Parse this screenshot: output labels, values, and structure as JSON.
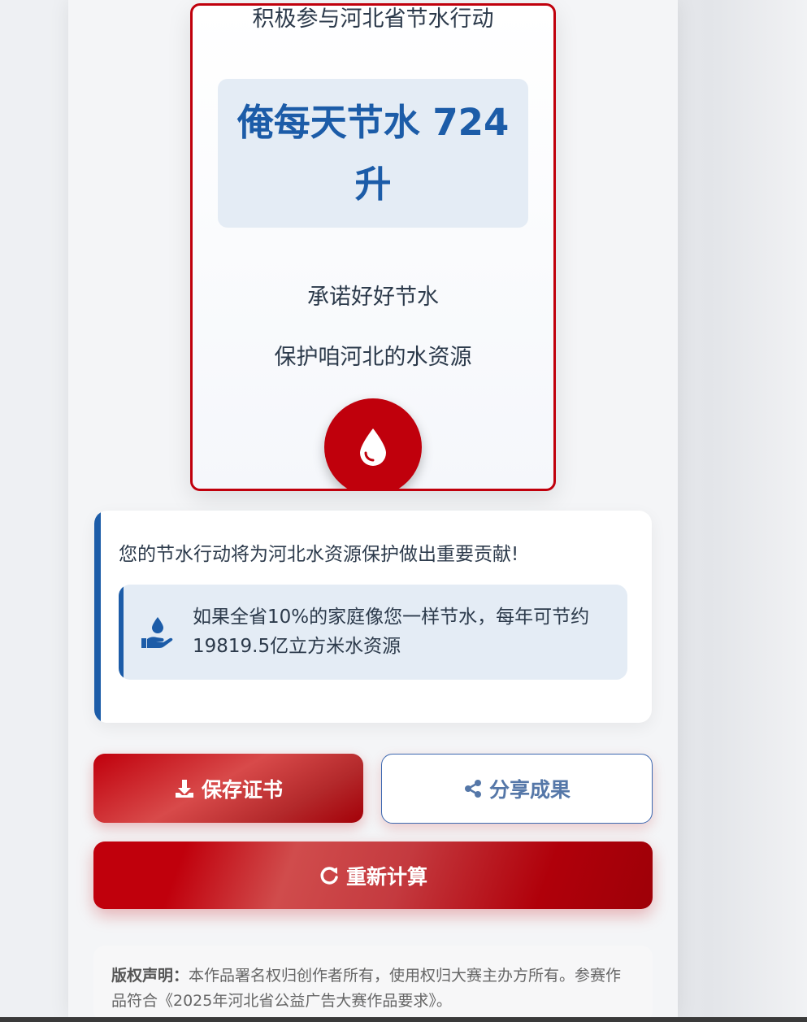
{
  "certificate": {
    "subtitle": "积极参与河北省节水行动",
    "amount": "俺每天节水 724 升",
    "pledge_line1": "承诺好好节水",
    "pledge_line2": "保护咱河北的水资源",
    "badge_icon": "water-drop-icon"
  },
  "impact": {
    "message": "您的节水行动将为河北水资源保护做出重要贡献!",
    "stat_icon": "hand-holding-water-icon",
    "stat_text": "如果全省10%的家庭像您一样节水，每年可节约19819.5亿立方米水资源"
  },
  "actions": {
    "save_label": "保存证书",
    "save_icon": "download-icon",
    "share_label": "分享成果",
    "share_icon": "share-icon",
    "recalc_label": "重新计算",
    "recalc_icon": "redo-icon"
  },
  "copyright": {
    "label": "版权声明：",
    "text": "本作品署名权归创作者所有，使用权归大赛主办方所有。参赛作品符合《2025年河北省公益广告大赛作品要求》。"
  },
  "colors": {
    "accent_red": "#c0000c",
    "accent_blue": "#1c5ca8"
  }
}
